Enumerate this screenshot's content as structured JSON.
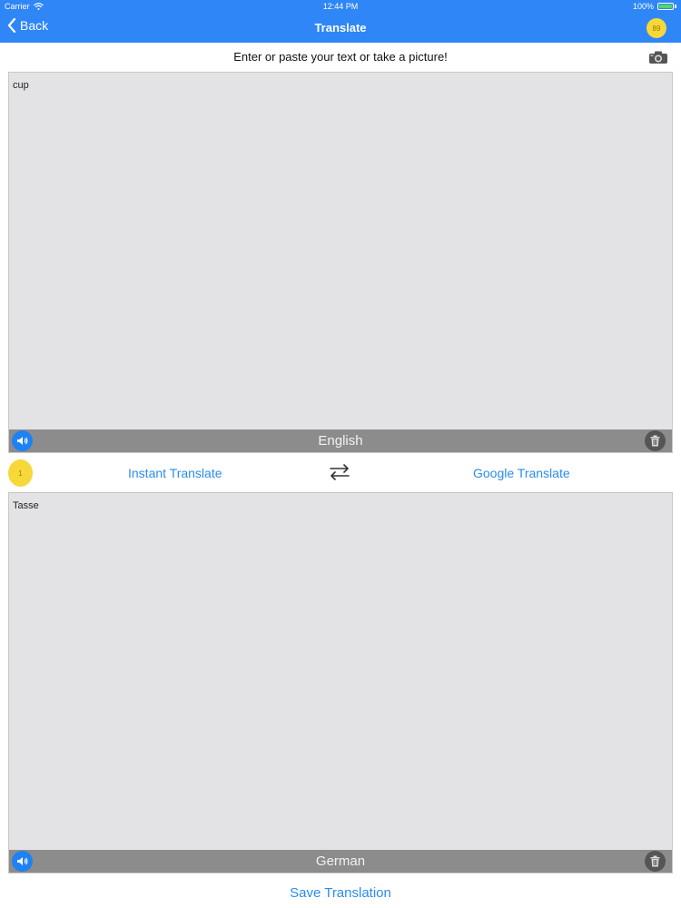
{
  "status": {
    "carrier": "Carrier",
    "time": "12:44 PM",
    "battery": "100%"
  },
  "nav": {
    "back_label": "Back",
    "title": "Translate",
    "coin_count": "89"
  },
  "prompt": {
    "text": "Enter or paste your text or take a picture!"
  },
  "source": {
    "text": "cup",
    "language": "English"
  },
  "controls": {
    "coin_count": "1",
    "instant_translate": "Instant Translate",
    "google_translate": "Google Translate"
  },
  "target": {
    "text": "Tasse",
    "language": "German"
  },
  "footer": {
    "save_label": "Save Translation"
  },
  "icons": {
    "back": "chevron-left-icon",
    "camera": "camera-icon",
    "speaker": "speaker-icon",
    "trash": "trash-icon",
    "swap": "swap-arrows-icon",
    "wifi": "wifi-icon",
    "battery": "battery-icon"
  },
  "colors": {
    "nav_bg": "#2f86f7",
    "link": "#2a8cf0",
    "textbox_bg": "#e3e2e4",
    "langbar_bg": "#8c8c8c",
    "coin": "#f6d83a",
    "battery_fill": "#4cd964"
  }
}
